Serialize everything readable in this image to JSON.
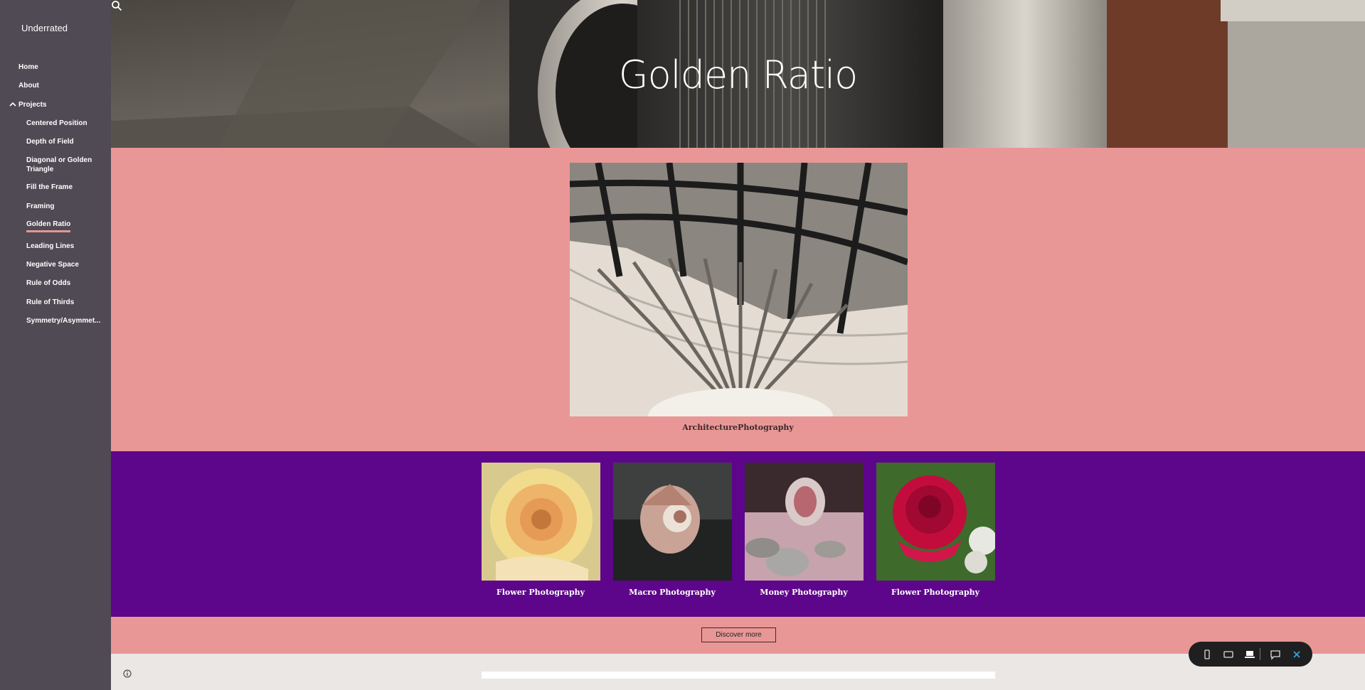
{
  "site": {
    "title": "Underrated"
  },
  "nav": {
    "home": "Home",
    "about": "About",
    "projects": "Projects",
    "sub_items": [
      {
        "label": "Centered Position",
        "active": false
      },
      {
        "label": "Depth of Field",
        "active": false
      },
      {
        "label": "Diagonal or Golden Triangle",
        "active": false
      },
      {
        "label": "Fill the Frame",
        "active": false
      },
      {
        "label": "Framing",
        "active": false
      },
      {
        "label": "Golden Ratio",
        "active": true
      },
      {
        "label": "Leading Lines",
        "active": false
      },
      {
        "label": "Negative Space",
        "active": false
      },
      {
        "label": "Rule of Odds",
        "active": false
      },
      {
        "label": "Rule of Thirds",
        "active": false
      },
      {
        "label": "Symmetry/Asymmet...",
        "active": false
      }
    ]
  },
  "header": {
    "title": "Golden Ratio"
  },
  "feature": {
    "caption": "ArchitecturePhotography"
  },
  "gallery": [
    {
      "caption": "Flower Photography"
    },
    {
      "caption": "Macro Photography"
    },
    {
      "caption": "Money Photography"
    },
    {
      "caption": "Flower Photography"
    }
  ],
  "cta": {
    "label": "Discover more"
  },
  "colors": {
    "sidebar": "#4f4a53",
    "pink": "#e99796",
    "purple": "#5e068b",
    "accent_underline": "#e89595",
    "footer": "#eae7e5"
  },
  "icons": {
    "search": "search-icon",
    "info": "info-icon",
    "chevron": "chevron-up-icon",
    "toolbar": [
      "phone-icon",
      "tablet-icon",
      "laptop-icon",
      "feedback-icon",
      "close-icon"
    ]
  }
}
